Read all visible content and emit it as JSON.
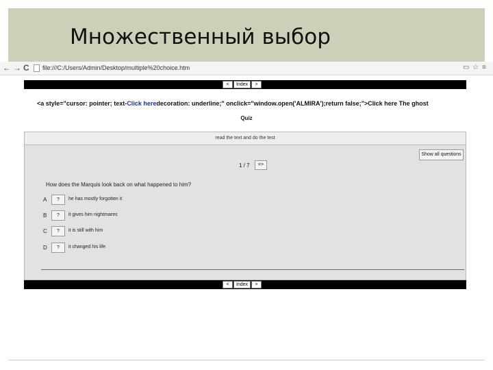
{
  "slide": {
    "title": "Множественный выбор"
  },
  "browser": {
    "back_icon": "←",
    "forward_icon": "→",
    "reload_icon": "C",
    "url": "file:///C:/Users/Admin/Desktop/multiple%20choice.htm",
    "star_icon": "☆",
    "page_action_icon": "▭",
    "menu_icon": "≡"
  },
  "quiz_nav": {
    "prev": "<",
    "index": "Index",
    "next": ">"
  },
  "code_line": {
    "part1": "<a style=\"cursor: pointer; text-",
    "link1": "Click here",
    "part2": "decoration: underline;\" onclick=\"window.open('ALMIRA');return false;\">",
    "part3": "Click here The ghost"
  },
  "quiz_label": "Quiz",
  "quiz": {
    "instruction": "read the text and do the test",
    "show_all": "Show all questions",
    "counter": "1 / 7",
    "next_button": "=>",
    "question": "How does the Marquis look back on what happened to him?",
    "options": [
      {
        "letter": "A",
        "button": "?",
        "text": "he has mostly forgotten it"
      },
      {
        "letter": "B",
        "button": "?",
        "text": "it gives him nightmares"
      },
      {
        "letter": "C",
        "button": "?",
        "text": "it is still with him"
      },
      {
        "letter": "D",
        "button": "?",
        "text": "it changed his life"
      }
    ]
  }
}
